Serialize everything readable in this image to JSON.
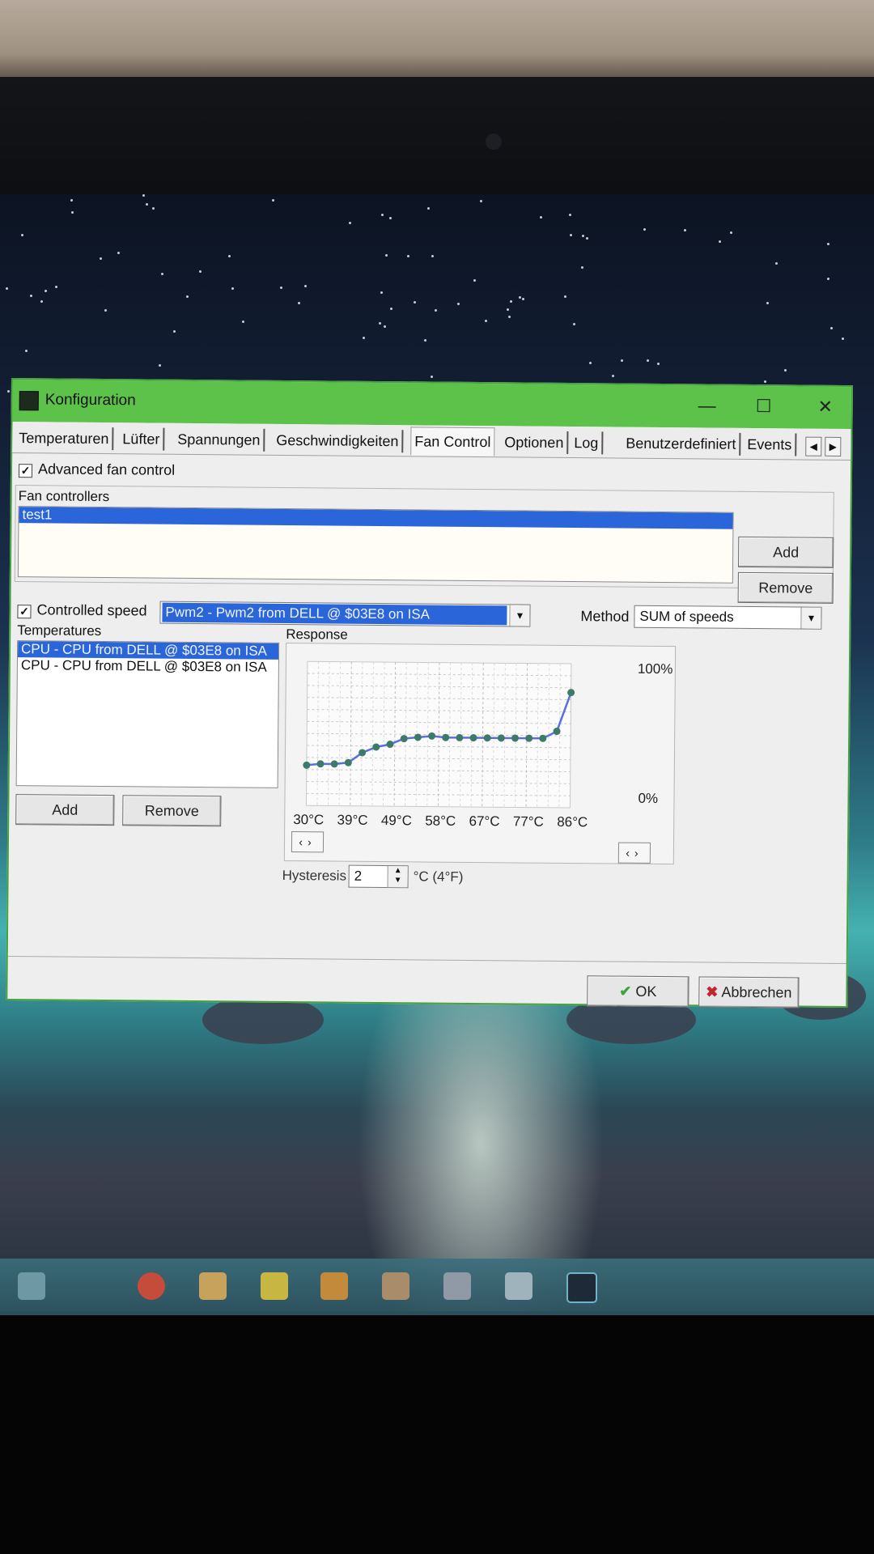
{
  "window": {
    "title": "Konfiguration",
    "minimize": "—",
    "maximize": "☐",
    "close": "✕"
  },
  "tabs": [
    {
      "label": "Temperaturen"
    },
    {
      "label": "Lüfter"
    },
    {
      "label": "Spannungen"
    },
    {
      "label": "Geschwindigkeiten"
    },
    {
      "label": "Fan Control",
      "active": true
    },
    {
      "label": "Optionen"
    },
    {
      "label": "Log"
    },
    {
      "label": "Benutzerdefiniert"
    },
    {
      "label": "Events"
    }
  ],
  "advanced": {
    "label": "Advanced fan control",
    "checked": true
  },
  "fan_controllers": {
    "label": "Fan controllers",
    "items": [
      "test1"
    ],
    "selected": 0,
    "add": "Add",
    "remove": "Remove"
  },
  "controlled_speed": {
    "label": "Controlled speed",
    "checked": true,
    "value": "Pwm2 - Pwm2 from DELL @ $03E8 on ISA"
  },
  "method": {
    "label": "Method",
    "value": "SUM of speeds"
  },
  "temperatures": {
    "label": "Temperatures",
    "items": [
      "CPU - CPU from DELL @ $03E8 on ISA",
      "CPU - CPU from DELL @ $03E8 on ISA"
    ],
    "selected": 0,
    "add": "Add",
    "remove": "Remove"
  },
  "response_label": "Response",
  "hysteresis": {
    "label": "Hysteresis",
    "value": "2",
    "unit": "°C (4°F)"
  },
  "buttons": {
    "ok": "OK",
    "cancel": "Abbrechen"
  },
  "colors": {
    "accent": "#5cc24a",
    "selection": "#2a66d9",
    "curve": "#5a6ee0",
    "point": "#3d7a6a"
  },
  "chart_data": {
    "type": "line",
    "xlabels": [
      "30°C",
      "39°C",
      "49°C",
      "58°C",
      "67°C",
      "77°C",
      "86°C"
    ],
    "ymax_label": "100%",
    "ymin_label": "0%",
    "x": [
      30,
      33,
      36,
      39,
      42,
      45,
      48,
      51,
      54,
      57,
      60,
      63,
      66,
      69,
      72,
      75,
      78,
      81,
      84,
      87
    ],
    "y": [
      28,
      29,
      29,
      30,
      37,
      41,
      43,
      47,
      48,
      49,
      48,
      48,
      48,
      48,
      48,
      48,
      48,
      48,
      53,
      80
    ],
    "xlim": [
      30,
      87
    ],
    "ylim": [
      0,
      100
    ],
    "grid": true
  }
}
